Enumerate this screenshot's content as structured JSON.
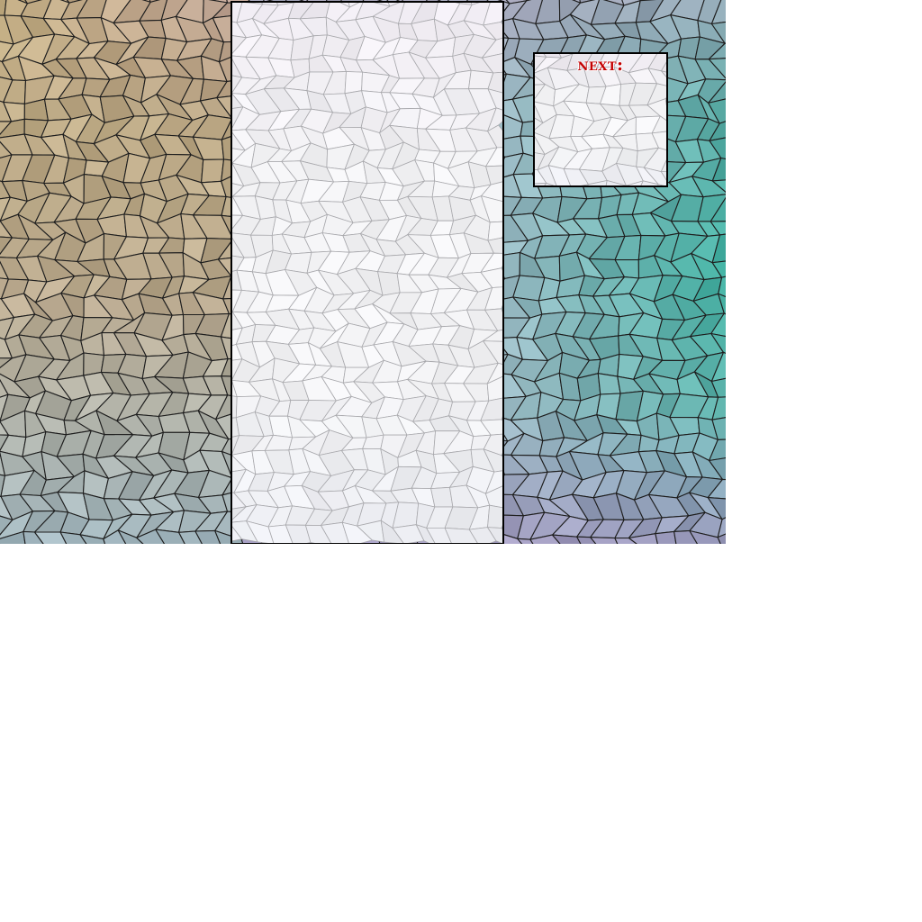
{
  "next_panel": {
    "label": "next:",
    "label_color": "#c40000"
  },
  "colors": {
    "page_background": "#ffffff",
    "panel_border": "#000000",
    "mosaic_grout": "#1e1e1e",
    "glass_tint": "#f2f2f4"
  },
  "background": {
    "style": "stained-glass mosaic",
    "color_stops": [
      "#c9b07a",
      "#b58fb0",
      "#9fb8c4",
      "#3fae9f",
      "#a694c0",
      "#b9a98f"
    ]
  },
  "playfield": {
    "state": "empty"
  }
}
